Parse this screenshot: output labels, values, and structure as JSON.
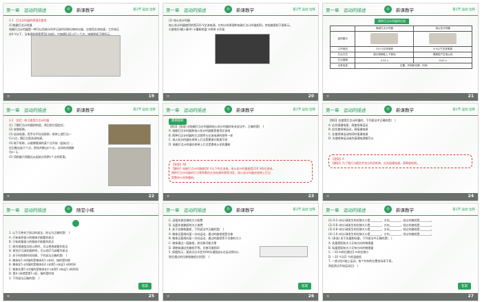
{
  "header": {
    "chapter": "第一章　运动的描述",
    "section": "新课教学",
    "practice": "随堂小练",
    "sub": "第3节 运动 位移"
  },
  "slides": [
    {
      "page": "19",
      "lines": [
        "3.1　打点计时器的原理及使用",
        "(1)电磁打点计时器",
        "电磁打点计时器是一种可以用来计时并记录时间和位移的仪器，它使用交流电源，工作电压",
        "在6 V以下，当电源的频率是50 Hz时，它每隔0.02 s打一个点，电路图如下图所示。"
      ]
    },
    {
      "page": "20",
      "lines": [
        "(2) 电火花计时器",
        "电火花计时器使用的是220 V交流电源，它的计时原理和电磁打点计时器相同，其电路图如下图所示。",
        "①放电针(输入脉冲) ②墨粉纸盘 ③纸带 ④负极"
      ]
    },
    {
      "page": "21",
      "title": "两种打点计时器的比较",
      "cols": [
        "",
        "电磁打点计时器",
        "电火花计时器"
      ],
      "rows": [
        [
          "结构图示",
          "",
          ""
        ],
        [
          "工作电压",
          "220 V交流电源",
          "6 V以下交流电源"
        ],
        [
          "打点方式",
          "振针周期性上下振动",
          "周期性产生电火花"
        ],
        [
          "打点周期",
          "0.02 s",
          "0.02 s"
        ],
        [
          "记录信息",
          "位置、时刻和位移、时间",
          ""
        ]
      ]
    },
    {
      "page": "22",
      "lines": [
        "3.2　实验：练习使用打点计时器",
        "(1) 了解打点计时器的构造，然后把它固定好。",
        "(2) 安装纸带。",
        "(3) 启动电源，用手水平拉动纸带，纸带上就打出一",
        "行小点，随后立即关闭电源。",
        "(4) 取下纸带，从能够看清的某个点开始（起始点），",
        "往后数出若干个点，例如共数出n个点，点间的间隔数",
        "为n−1。",
        "(5) 用刻度尺测量出从起始点到第n个点的距离。"
      ]
    },
    {
      "page": "23",
      "tag": "典例剖析",
      "lines": [
        "【例1】(多选) 对电磁打点计时器和电火花计时器的有关说法中，正确的是(　)",
        "A. 电磁打点计时器和电火花计时器都是使用交流电",
        "B. 两种打点计时器的打点频率与交流电源的频率一样",
        "C. 电火花计时器在纸带上打点是靠振针和复写纸",
        "D. 电磁打点计时器在纸带上打点是靠电火花和墨粉"
      ],
      "answer": [
        "【答案】AB",
        "【解析】电磁打点计时器使用6 V以下的交流电，电火花计时器使用220 V的交流电，",
        "两种打点计时器的打点频率都由交流电源的频率决定，电火花计时器在纸带上打点",
        "是靠电火花和墨粉。"
      ]
    },
    {
      "page": "24",
      "lines": [
        "【例2】在使用打点计时器时，下列说法中正确的是(　)",
        "A. 应先接通电源，再使纸带运动",
        "B. 应先使纸带运动，再接通电源",
        "C. 在使纸带运动的同时接通电源",
        "D. 先使纸带运动或先接通电源都可以"
      ],
      "answer": [
        "【答案】A",
        "【解析】为了使打点稳定并充分利用纸带，应先接通电源，再释放纸带。"
      ]
    },
    {
      "page": "25",
      "lines": [
        "1. 以下几种关于质点的说法，你认为正确的是(　)",
        "A. 只有体积很小的物体才能看作质点",
        "B. 只有质量很小的物体才能看作质点",
        "C. 研究地球绕太阳公转时，可以把地球看作质点",
        "D. 研究乒乓球的旋转时，可以把乒乓球看作质点",
        "2. 关于时刻和时间间隔，下列说法正确的是(　)",
        "A. 物体在5 s时指的是物体在5 s末时，指的是时刻",
        "B. 物体在5 s内指的是物体在4 s末到5 s末这1 s的时间",
        "C. 物体在第5 s内指的是物体在4 s末到5 s末这1 s的时间",
        "D. 第4 s末就是第5 s初，指的是时刻",
        "3. 下列说法正确的是(　)"
      ]
    },
    {
      "page": "26",
      "lines": [
        "C. 出租车按位移的大小收费",
        "D. 出租车按路程的大小收费",
        "4. 关于位移和路程，下列说法中正确的是(　)",
        "A. 物体沿直线向某一方向运动，通过的路程就是位移",
        "B. 物体沿直线向某一方向运动，通过的路程等于位移的大小",
        "C. 物体通过一段路程，其位移可能为零",
        "D. 两物体通过的路程不等，位移可能相同",
        "5. 如图所示，某质点沿半径为R的半圆弧由a点运动到b点，",
        "则它通过的位移和路程分别是(　)"
      ]
    },
    {
      "page": "27",
      "lines": [
        "(1) 0.2 s内小球发生的位移大小是________，方向________，经过的路程是________。",
        "(2) 0.6 s内小球发生的位移大小是________，方向________，经过的路程是________。",
        "(3) 0.8 s内小球发生的位移大小是________，方向________，经过的路程是________。",
        "(4) 1.0 s内小球发生的位移大小是________，方向________，经过的路程是________。",
        "6. (多选) 关于矢量和标量，下列说法中正确的是(　)",
        "A. 矢量是既有大小又有方向的物理量",
        "B. 标量是既有大小又有方向的物理量",
        "C. −10 m的位移比5 m的位移小",
        "D. −10 ℃比5 ℃的温度低",
        "7. 一质点在x轴上运动，各个时刻的位置坐标如下表，",
        "则此质点开始运动后(　)"
      ]
    }
  ],
  "answer_button": "答案"
}
